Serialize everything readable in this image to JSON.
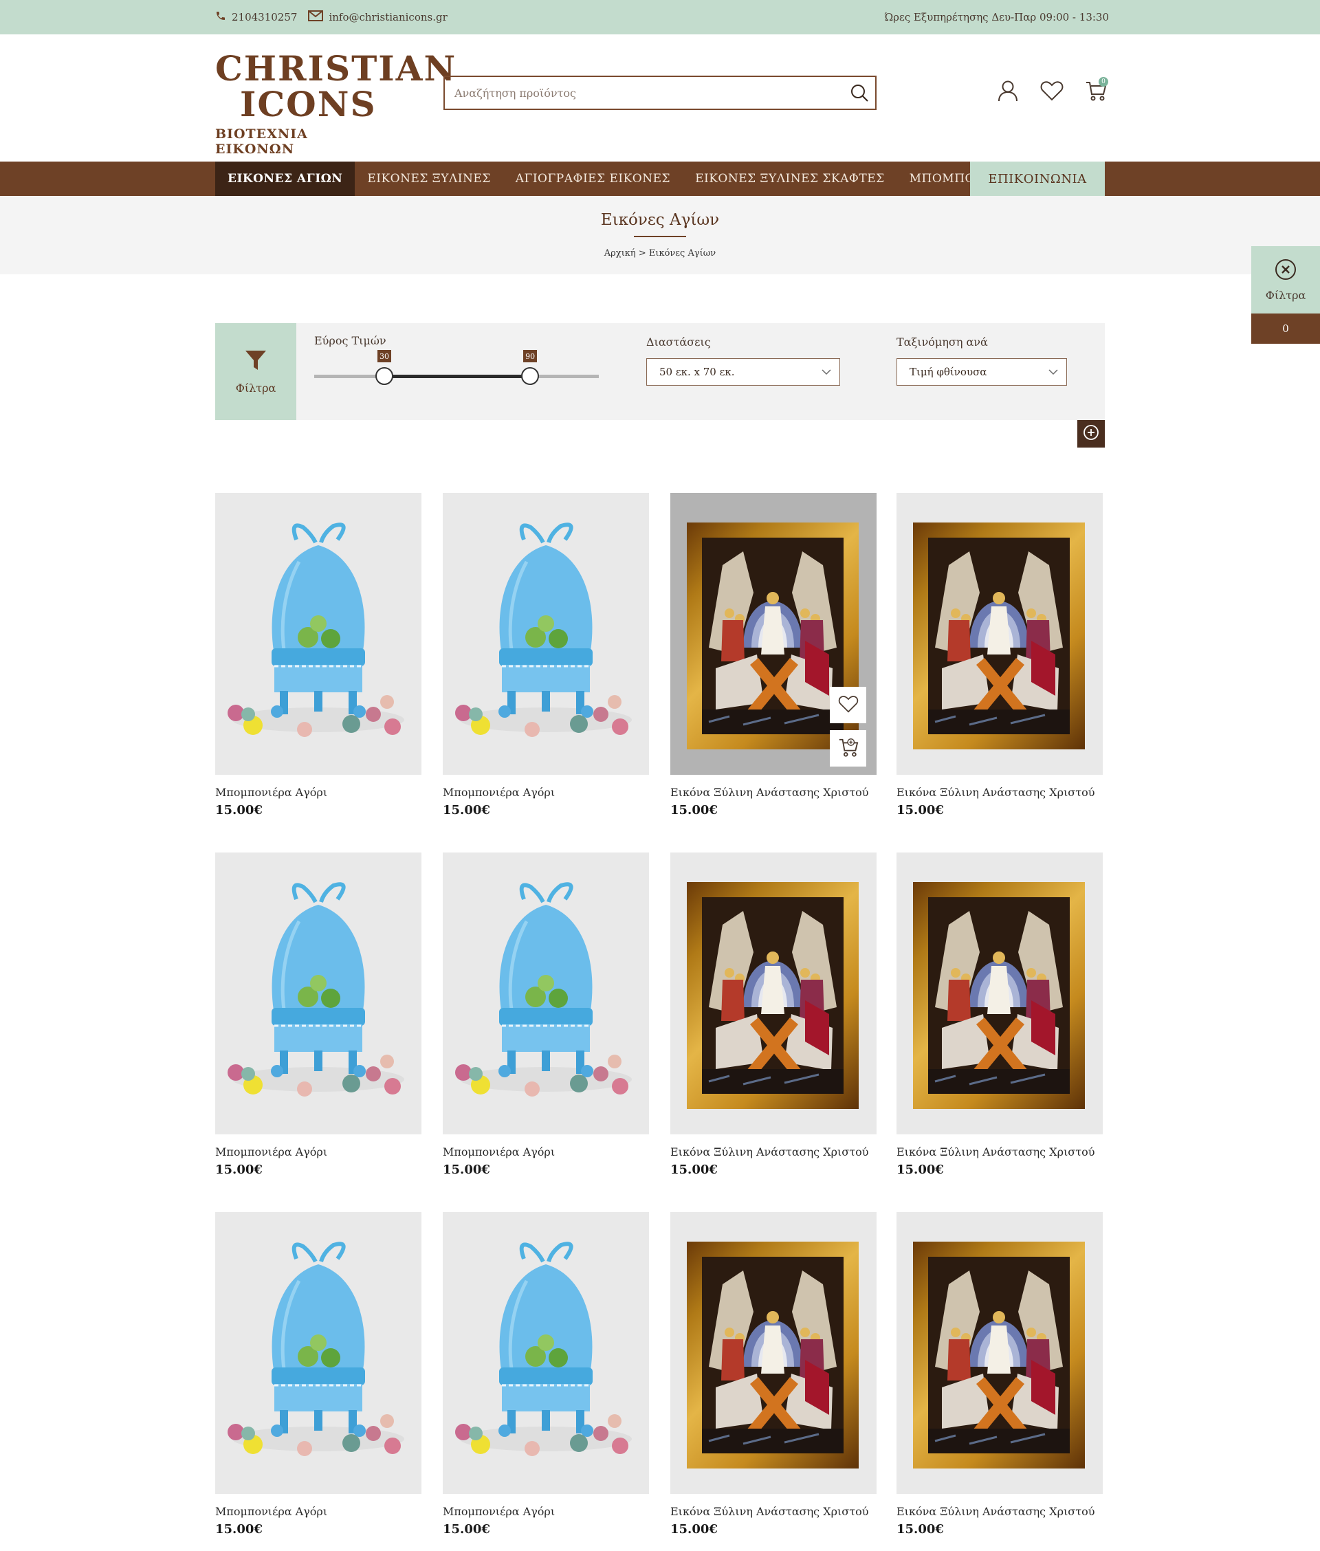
{
  "topbar": {
    "phone": "2104310257",
    "email": "info@christianicons.gr",
    "hours": "Ώρες Εξυπηρέτησης Δευ-Παρ 09:00 - 13:30"
  },
  "header": {
    "logo_line1": "CHRISTIAN",
    "logo_line2": "ICONS",
    "logo_line3": "ΒΙΟΤΕΧΝΙΑ ΕΙΚΟΝΩΝ",
    "search_placeholder": "Αναζήτηση προϊόντος",
    "cart_count": "0"
  },
  "nav": {
    "items": [
      {
        "label": "ΕΙΚΟΝΕΣ ΑΓΙΩΝ"
      },
      {
        "label": "ΕΙΚΟΝΕΣ ΞΥΛΙΝΕΣ"
      },
      {
        "label": "ΑΓΙΟΓΡΑΦΙΕΣ ΕΙΚΟΝΕΣ"
      },
      {
        "label": "ΕΙΚΟΝΕΣ ΞΥΛΙΝΕΣ ΣΚΑΦΤΕΣ"
      },
      {
        "label": "ΜΠΟΜΠΟΝΙΕΡΕΣ"
      }
    ],
    "contact": "ΕΠΙΚΟΙΝΩΝΙΑ"
  },
  "hero": {
    "title": "Εικόνες Αγίων",
    "breadcrumb": "Αρχική > Εικόνες Αγίων"
  },
  "side_filter": {
    "label": "Φίλτρα",
    "count": "0"
  },
  "filters": {
    "tab_label": "Φίλτρα",
    "price_label": "Εύρος Τιμών",
    "price_min": "30",
    "price_max": "90",
    "price_min_fraction": 0.25,
    "price_max_fraction": 0.77,
    "dimensions_label": "Διαστάσεις",
    "dimensions_value": "50 εκ. x 70 εκ.",
    "sort_label": "Ταξινόμηση ανά",
    "sort_value": "Τιμή φθίνουσα"
  },
  "products": [
    {
      "name": "Μπομπονιέρα Αγόρι",
      "price": "15.00€",
      "image": "bonbonniere"
    },
    {
      "name": "Μπομπονιέρα Αγόρι",
      "price": "15.00€",
      "image": "bonbonniere"
    },
    {
      "name": "Εικόνα Ξύλινη Ανάστασης Χριστού",
      "price": "15.00€",
      "image": "icon"
    },
    {
      "name": "Εικόνα Ξύλινη Ανάστασης Χριστού",
      "price": "15.00€",
      "image": "icon"
    },
    {
      "name": "Μπομπονιέρα Αγόρι",
      "price": "15.00€",
      "image": "bonbonniere"
    },
    {
      "name": "Μπομπονιέρα Αγόρι",
      "price": "15.00€",
      "image": "bonbonniere"
    },
    {
      "name": "Εικόνα Ξύλινη Ανάστασης Χριστού",
      "price": "15.00€",
      "image": "icon"
    },
    {
      "name": "Εικόνα Ξύλινη Ανάστασης Χριστού",
      "price": "15.00€",
      "image": "icon"
    },
    {
      "name": "Μπομπονιέρα Αγόρι",
      "price": "15.00€",
      "image": "bonbonniere"
    },
    {
      "name": "Μπομπονιέρα Αγόρι",
      "price": "15.00€",
      "image": "bonbonniere"
    },
    {
      "name": "Εικόνα Ξύλινη Ανάστασης Χριστού",
      "price": "15.00€",
      "image": "icon"
    },
    {
      "name": "Εικόνα Ξύλινη Ανάστασης Χριστού",
      "price": "15.00€",
      "image": "icon"
    }
  ],
  "colors": {
    "mint": "#c3dccd",
    "brown": "#6e4126",
    "dark_brown": "#3c2416"
  }
}
